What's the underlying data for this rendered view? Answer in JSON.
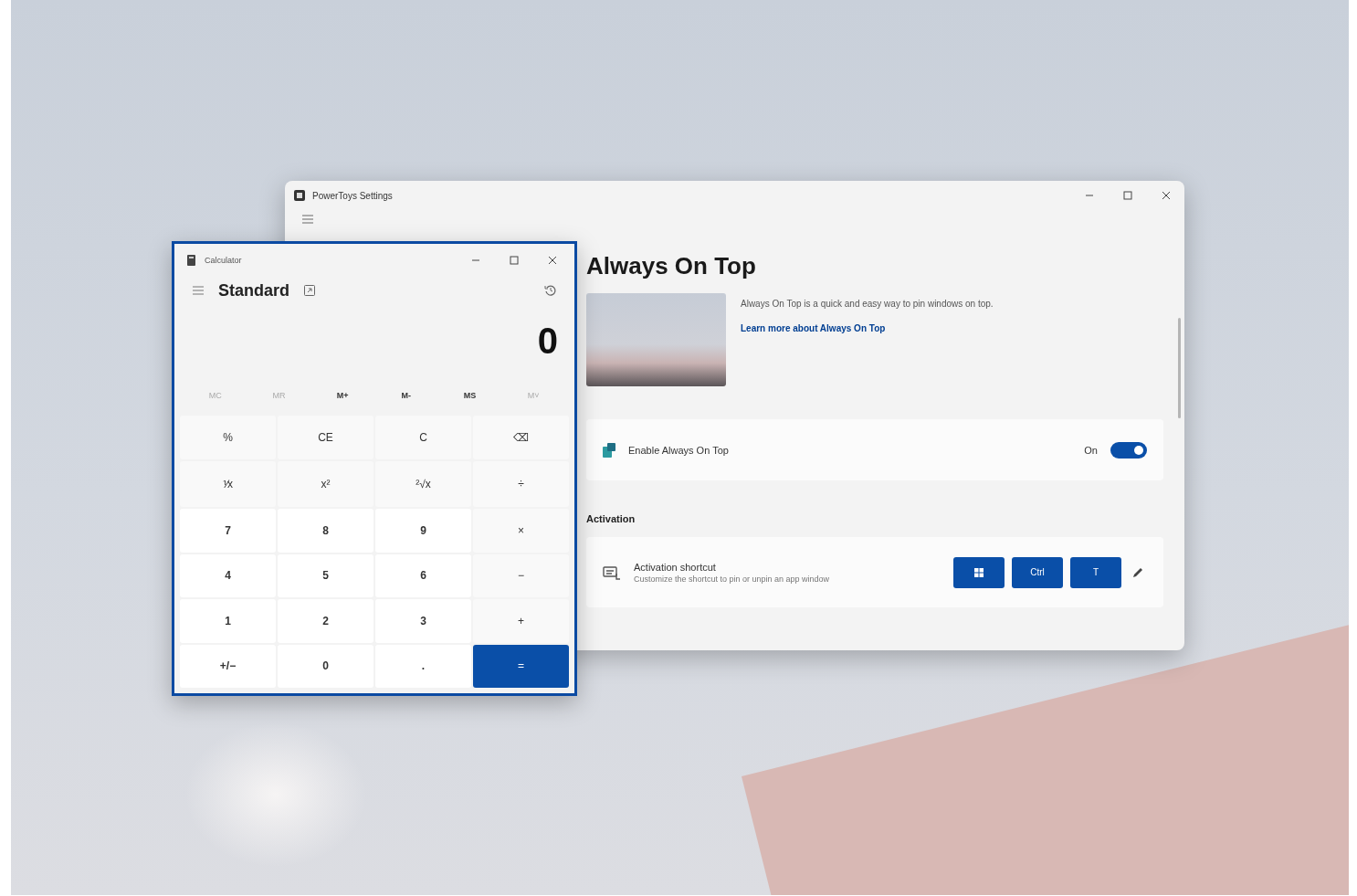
{
  "settings_window": {
    "title": "PowerToys Settings",
    "page": {
      "title": "Always On Top",
      "description": "Always On Top is a quick and easy way to pin windows on top.",
      "link": "Learn more about Always On Top",
      "enable_card": {
        "label": "Enable Always On Top",
        "state_label": "On",
        "on": true
      },
      "section": "Activation",
      "shortcut_card": {
        "title": "Activation shortcut",
        "subtitle": "Customize the shortcut to pin or unpin an app window",
        "keys": [
          {
            "kind": "win"
          },
          {
            "kind": "text",
            "label": "Ctrl"
          },
          {
            "kind": "text",
            "label": "T"
          }
        ]
      }
    }
  },
  "calculator": {
    "title": "Calculator",
    "mode": "Standard",
    "display": "0",
    "memory": [
      {
        "label": "MC",
        "disabled": true
      },
      {
        "label": "MR",
        "disabled": true
      },
      {
        "label": "M+",
        "disabled": false
      },
      {
        "label": "M-",
        "disabled": false
      },
      {
        "label": "MS",
        "disabled": false
      },
      {
        "label": "M˅",
        "disabled": true
      }
    ],
    "keys": [
      {
        "label": "%",
        "kind": "function"
      },
      {
        "label": "CE",
        "kind": "function"
      },
      {
        "label": "C",
        "kind": "function"
      },
      {
        "label": "⌫",
        "kind": "function"
      },
      {
        "label": "⅟x",
        "kind": "function"
      },
      {
        "label": "x²",
        "kind": "function"
      },
      {
        "label": "²√x",
        "kind": "function"
      },
      {
        "label": "÷",
        "kind": "function"
      },
      {
        "label": "7",
        "kind": "number"
      },
      {
        "label": "8",
        "kind": "number"
      },
      {
        "label": "9",
        "kind": "number"
      },
      {
        "label": "×",
        "kind": "function"
      },
      {
        "label": "4",
        "kind": "number"
      },
      {
        "label": "5",
        "kind": "number"
      },
      {
        "label": "6",
        "kind": "number"
      },
      {
        "label": "−",
        "kind": "function"
      },
      {
        "label": "1",
        "kind": "number"
      },
      {
        "label": "2",
        "kind": "number"
      },
      {
        "label": "3",
        "kind": "number"
      },
      {
        "label": "+",
        "kind": "function"
      },
      {
        "label": "+/−",
        "kind": "number"
      },
      {
        "label": "0",
        "kind": "number"
      },
      {
        "label": ".",
        "kind": "number"
      },
      {
        "label": "=",
        "kind": "equals"
      }
    ]
  }
}
